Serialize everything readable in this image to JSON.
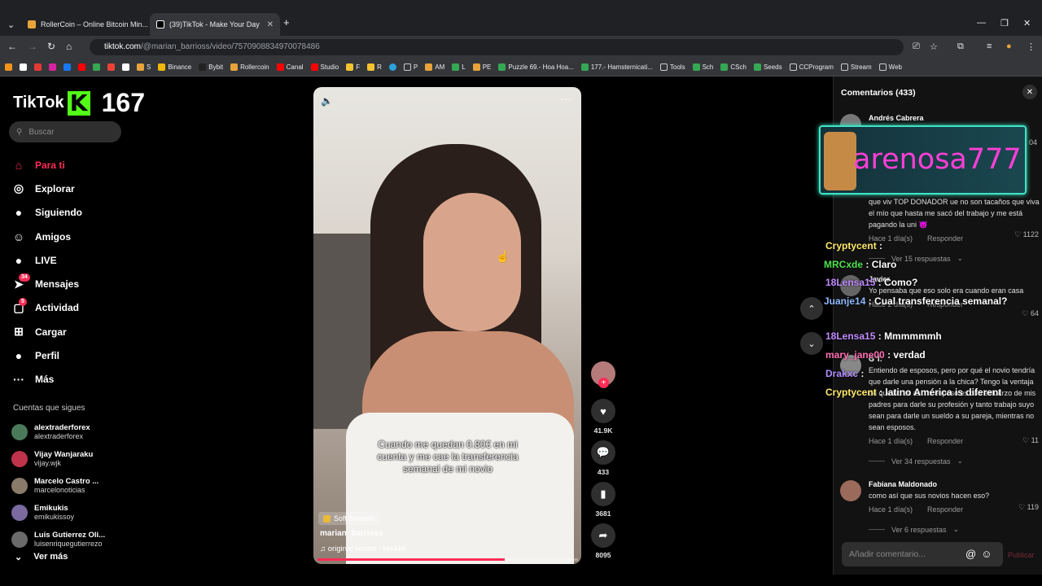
{
  "browser": {
    "tabs": [
      {
        "title": "RollerCoin – Online Bitcoin Min...",
        "active": false
      },
      {
        "title": "(39)TikTok - Make Your Day",
        "active": true
      }
    ],
    "url_host": "tiktok.com",
    "url_path": "/@marian_barrioss/video/7570908834970078486",
    "bookmarks": [
      "S",
      "Binance",
      "Bybit",
      "Rollercoin",
      "Canal",
      "Studio",
      "F",
      "R",
      "P",
      "AM",
      "L",
      "PE",
      "Puzzle 69.- Hoa Hoa...",
      "177.- Hamsternicati...",
      "Tools",
      "Sch",
      "CSch",
      "Seeds",
      "CCProgram",
      "Stream",
      "Web"
    ]
  },
  "sidebar": {
    "logo_text": "TikTok",
    "kick_letter": "K",
    "count": "167",
    "search_placeholder": "Buscar",
    "nav": [
      {
        "label": "Para ti",
        "icon": "home-icon",
        "glyph": "⌂",
        "active": true,
        "badge": ""
      },
      {
        "label": "Explorar",
        "icon": "compass-icon",
        "glyph": "◎",
        "active": false,
        "badge": ""
      },
      {
        "label": "Siguiendo",
        "icon": "following-icon",
        "glyph": "●",
        "active": false,
        "badge": ""
      },
      {
        "label": "Amigos",
        "icon": "friends-icon",
        "glyph": "☺",
        "active": false,
        "badge": ""
      },
      {
        "label": "LIVE",
        "icon": "live-icon",
        "glyph": "●",
        "active": false,
        "badge": ""
      },
      {
        "label": "Mensajes",
        "icon": "messages-icon",
        "glyph": "➤",
        "active": false,
        "badge": "34"
      },
      {
        "label": "Actividad",
        "icon": "activity-icon",
        "glyph": "▢",
        "active": false,
        "badge": "5"
      },
      {
        "label": "Cargar",
        "icon": "upload-icon",
        "glyph": "⊞",
        "active": false,
        "badge": ""
      },
      {
        "label": "Perfil",
        "icon": "profile-icon",
        "glyph": "●",
        "active": false,
        "badge": ""
      },
      {
        "label": "Más",
        "icon": "more-icon",
        "glyph": "···",
        "active": false,
        "badge": ""
      }
    ],
    "following_title": "Cuentas que sigues",
    "following": [
      {
        "name": "alextraderforex",
        "handle": "alextraderforex",
        "color": "#4a7a5a"
      },
      {
        "name": "Vijay Wanjaraku",
        "handle": "vijay.wjk",
        "color": "#c0334a"
      },
      {
        "name": "Marcelo Castro ...",
        "handle": "marcelonoticias",
        "color": "#8a7a6a"
      },
      {
        "name": "Emikukis",
        "handle": "emikukissoy",
        "color": "#7a6aa0"
      },
      {
        "name": "Luis Gutierrez Oli...",
        "handle": "luisenriquegutierrezo",
        "color": "#6a6a6a"
      }
    ],
    "see_more": "Ver más"
  },
  "video": {
    "caption": "Cuando me quedan 0.80€ en mi cuenta y me cae la transferencia semanal de mi novio",
    "effect": "Soft Smooth",
    "author": "marian_barrioss",
    "sound": "original sound - kkkkkk",
    "progress": 0.72
  },
  "actions": {
    "likes": "41.9K",
    "comments": "433",
    "saves": "3681",
    "shares": "8095"
  },
  "comments": {
    "title": "Comentarios (433)",
    "input_placeholder": "Añadir comentario...",
    "publish": "Publicar",
    "items": [
      {
        "user": "Andrés Cabrera",
        "text": "",
        "date": "",
        "reply": "",
        "likes": "",
        "replies": "",
        "color": "#777"
      },
      {
        "user": "",
        "text": "que viv TOP DONADOR ue no son tacaños que viva el mío que hasta me sacó del trabajo y me está pagando la uni 😈",
        "date": "Hace 1 día(s)",
        "reply": "Responder",
        "likes": "1122",
        "replies": "Ver 15 respuestas",
        "color": "#555"
      },
      {
        "user": "Javier",
        "text": "Yo pensaba que eso solo era cuando eran casa",
        "date": "Hace 2 día(s)",
        "reply": "Responder",
        "likes": "64",
        "replies": "",
        "color": "#666"
      },
      {
        "user": "G T.",
        "text": "Entiendo de esposos, pero por qué el novio tendría que darle una pensión a la chica? Tengo la ventaja de que no es así mi esposo es con esfuerzo de mis padres para darle su profesión y tanto trabajo suyo sean para darle un sueldo a su pareja, mientras no sean esposos.",
        "date": "Hace 1 día(s)",
        "reply": "Responder",
        "likes": "11",
        "replies": "Ver 34 respuestas",
        "color": "#888"
      },
      {
        "user": "Fabiana Maldonado",
        "text": "como así que sus novios hacen eso?",
        "date": "Hace 1 día(s)",
        "reply": "Responder",
        "likes": "119",
        "replies": "Ver 6 respuestas",
        "color": "#9a6a5a"
      }
    ],
    "side_count": "04"
  },
  "donor_overlay": {
    "name": "arenosa777"
  },
  "chat_overlay": [
    {
      "user": "Cryptycent",
      "msg": "",
      "color": "#ffe96b"
    },
    {
      "user": "MRCxde",
      "msg": "Claro",
      "color": "#4fe14f"
    },
    {
      "user": "18Lensa15",
      "msg": "Como?",
      "color": "#c18cff"
    },
    {
      "user": "Juanje14",
      "msg": "Cual transferencia semanal?",
      "color": "#8fb8ff"
    },
    {
      "user": "18Lensa15",
      "msg": "Mmmmmmh",
      "color": "#c18cff"
    },
    {
      "user": "mary_jane00",
      "msg": "verdad",
      "color": "#ff6fb4"
    },
    {
      "user": "Drakxc",
      "msg": "",
      "color": "#b08cff"
    },
    {
      "user": "Cryptycent",
      "msg": "latino América is diferent",
      "color": "#ffe96b"
    }
  ]
}
